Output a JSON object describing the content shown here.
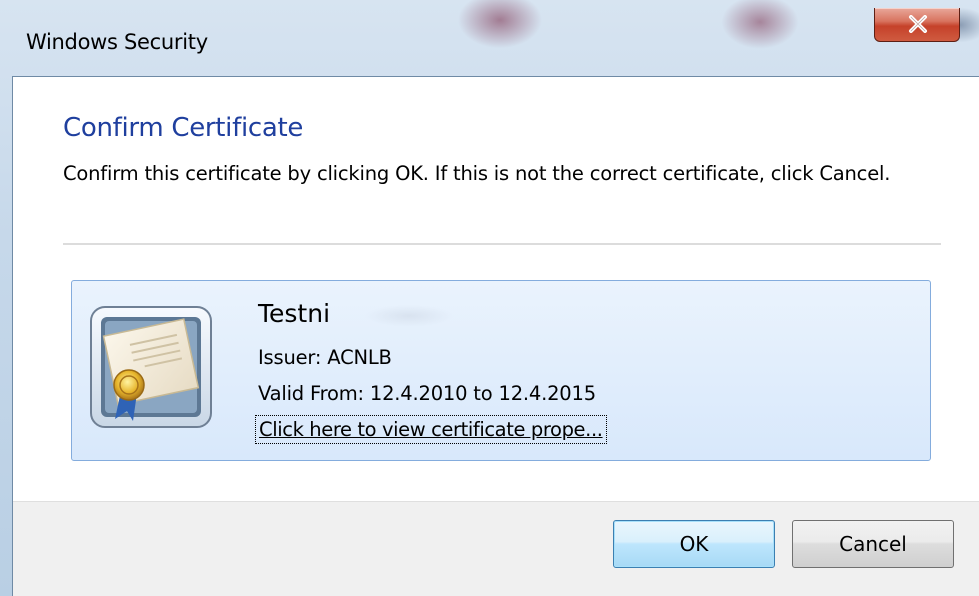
{
  "window": {
    "title": "Windows Security",
    "close_icon": "close-x-icon",
    "accent_color": "#c5412a"
  },
  "dialog": {
    "heading": "Confirm Certificate",
    "instructions": "Confirm this certificate by clicking OK. If this is not the correct certificate, click Cancel.",
    "heading_color": "#1f3f9e"
  },
  "certificate": {
    "icon": "certificate-icon",
    "name": "Testni",
    "issuer": "Issuer: ACNLB",
    "valid": "Valid From: 12.4.2010 to 12.4.2015",
    "link": "Click here to view certificate prope..."
  },
  "buttons": {
    "ok": "OK",
    "cancel": "Cancel"
  }
}
